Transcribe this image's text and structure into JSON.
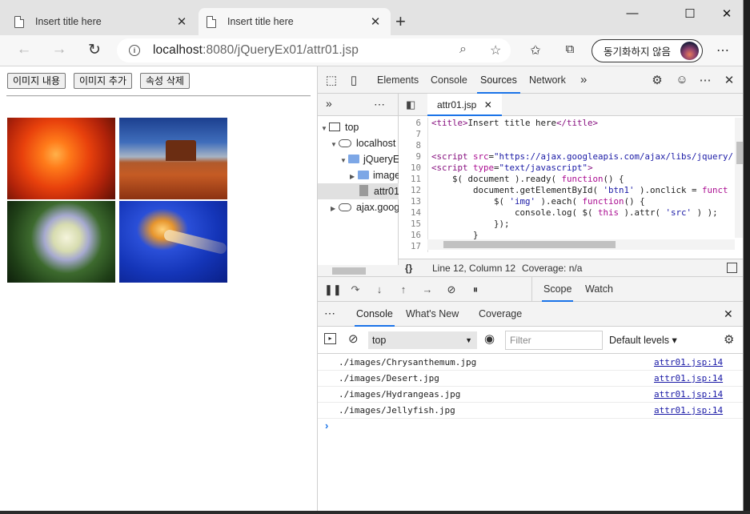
{
  "browser": {
    "tabs": [
      {
        "title": "Insert title here",
        "active": false
      },
      {
        "title": "Insert title here",
        "active": true
      }
    ],
    "new_tab": "+",
    "window": {
      "minimize": "—",
      "maximize": "☐",
      "close": "✕"
    },
    "url": {
      "host": "localhost",
      "rest": ":8080/jQueryEx01/attr01.jsp"
    },
    "sync_label": "동기화하지 않음",
    "more": "⋯"
  },
  "page": {
    "buttons": [
      "이미지 내용",
      "이미지 추가",
      "속성 삭제"
    ],
    "images": [
      "Chrysanthemum",
      "Desert",
      "Hydrangeas",
      "Jellyfish"
    ]
  },
  "devtools": {
    "tabs": [
      "Elements",
      "Console",
      "Sources",
      "Network"
    ],
    "active_tab": "Sources",
    "more_tabs": "»",
    "navigator": {
      "items": [
        {
          "label": "top",
          "indent": 0,
          "arrow": "▼",
          "icon": "frame"
        },
        {
          "label": "localhost",
          "indent": 1,
          "arrow": "▼",
          "icon": "cloud"
        },
        {
          "label": "jQueryEx01",
          "indent": 2,
          "arrow": "▼",
          "icon": "folder"
        },
        {
          "label": "images",
          "indent": 3,
          "arrow": "▶",
          "icon": "folder"
        },
        {
          "label": "attr01.jsp",
          "indent": 3,
          "arrow": "",
          "icon": "file",
          "selected": true
        },
        {
          "label": "ajax.googleapis.com",
          "indent": 1,
          "arrow": "▶",
          "icon": "cloud"
        }
      ]
    },
    "editor": {
      "file_tab": "attr01.jsp",
      "lines": [
        {
          "n": "6",
          "parts": [
            [
              "tag",
              "<title>"
            ],
            [
              "",
              "Insert title here"
            ],
            [
              "tag",
              "</title>"
            ]
          ]
        },
        {
          "n": "7",
          "parts": []
        },
        {
          "n": "8",
          "parts": []
        },
        {
          "n": "9",
          "parts": [
            [
              "tag",
              "<script "
            ],
            [
              "kw",
              "src"
            ],
            [
              "",
              "="
            ],
            [
              "str",
              "\"https://ajax.googleapis.com/ajax/libs/jquery/"
            ]
          ]
        },
        {
          "n": "10",
          "parts": [
            [
              "tag",
              "<script "
            ],
            [
              "kw",
              "type"
            ],
            [
              "",
              "="
            ],
            [
              "str",
              "\"text/javascript\""
            ],
            [
              "tag",
              ">"
            ]
          ]
        },
        {
          "n": "11",
          "parts": [
            [
              "",
              "    $( document ).ready( "
            ],
            [
              "kw",
              "function"
            ],
            [
              "",
              "() {"
            ]
          ]
        },
        {
          "n": "12",
          "parts": [
            [
              "",
              "        document.getElementById( "
            ],
            [
              "str",
              "'btn1'"
            ],
            [
              "",
              " ).onclick = "
            ],
            [
              "kw",
              "funct"
            ]
          ]
        },
        {
          "n": "13",
          "parts": [
            [
              "",
              "            $( "
            ],
            [
              "str",
              "'img'"
            ],
            [
              "",
              " ).each( "
            ],
            [
              "kw",
              "function"
            ],
            [
              "",
              "() {"
            ]
          ]
        },
        {
          "n": "14",
          "parts": [
            [
              "",
              "                console.log( $( "
            ],
            [
              "kw",
              "this"
            ],
            [
              "",
              " ).attr( "
            ],
            [
              "str",
              "'src'"
            ],
            [
              "",
              " ) );"
            ]
          ]
        },
        {
          "n": "15",
          "parts": [
            [
              "",
              "            });"
            ]
          ]
        },
        {
          "n": "16",
          "parts": [
            [
              "",
              "        }"
            ]
          ]
        },
        {
          "n": "17",
          "parts": []
        }
      ],
      "status": {
        "braces": "{}",
        "position": "Line 12, Column 12",
        "coverage": "Coverage: n/a"
      }
    },
    "debugger": {
      "tabs": [
        "Scope",
        "Watch"
      ],
      "active": "Scope"
    },
    "drawer": {
      "tabs": [
        "Console",
        "What's New",
        "Coverage"
      ],
      "active": "Console",
      "context": "top",
      "filter_placeholder": "Filter",
      "levels": "Default levels ▾",
      "logs": [
        {
          "message": "./images/Chrysanthemum.jpg",
          "source": "attr01.jsp:14"
        },
        {
          "message": "./images/Desert.jpg",
          "source": "attr01.jsp:14"
        },
        {
          "message": "./images/Hydrangeas.jpg",
          "source": "attr01.jsp:14"
        },
        {
          "message": "./images/Jellyfish.jpg",
          "source": "attr01.jsp:14"
        }
      ],
      "prompt": "›"
    }
  }
}
